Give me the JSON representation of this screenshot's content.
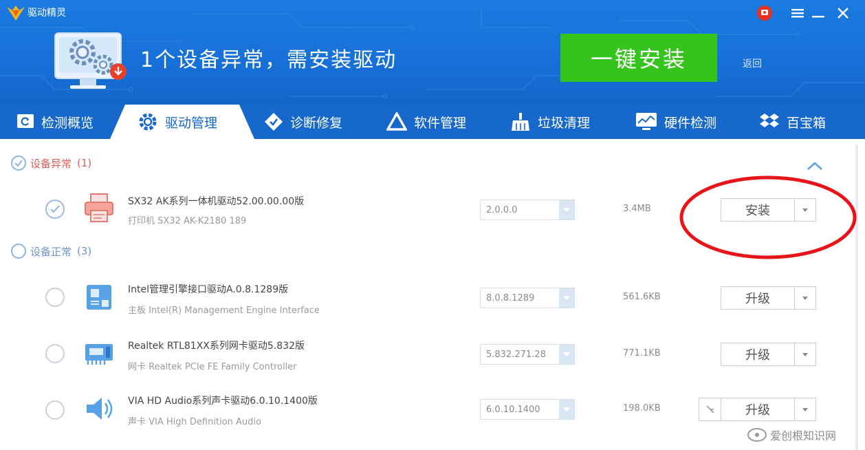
{
  "app": {
    "name": "驱动精灵"
  },
  "header": {
    "headline": "1个设备异常，需安装驱动",
    "install_all_label": "一键安装",
    "back_label": "返回"
  },
  "tabs": [
    {
      "label": "检测概览",
      "icon": "monitor-refresh-icon"
    },
    {
      "label": "驱动管理",
      "icon": "gear-icon",
      "active": true
    },
    {
      "label": "诊断修复",
      "icon": "diamond-wrench-icon"
    },
    {
      "label": "软件管理",
      "icon": "triangle-logo-icon"
    },
    {
      "label": "垃圾清理",
      "icon": "broom-icon"
    },
    {
      "label": "硬件检测",
      "icon": "chart-monitor-icon"
    },
    {
      "label": "百宝箱",
      "icon": "dropbox-icon"
    }
  ],
  "groups": {
    "abnormal": {
      "label": "设备异常",
      "count": "(1)"
    },
    "normal": {
      "label": "设备正常",
      "count": "(3)"
    }
  },
  "devices": [
    {
      "name": "SX32 AK系列一体机驱动52.00.00.00版",
      "sub": "打印机   SX32 AK-K2180 189",
      "version": "2.0.0.0",
      "size": "3.4MB",
      "action": "安装",
      "checked": true,
      "icon": "printer-icon"
    },
    {
      "name": "Intel管理引擎接口驱动A.0.8.1289版",
      "sub": "主板   Intel(R) Management Engine Interface",
      "version": "8.0.8.1289",
      "size": "561.6KB",
      "action": "升级",
      "checked": false,
      "icon": "motherboard-icon"
    },
    {
      "name": "Realtek RTL81XX系列网卡驱动5.832版",
      "sub": "网卡   Realtek PCIe FE Family Controller",
      "version": "5.832.271.28",
      "size": "771.1KB",
      "action": "升级",
      "checked": false,
      "icon": "network-card-icon"
    },
    {
      "name": "VIA HD Audio系列声卡驱动6.0.10.1400版",
      "sub": "声卡   VIA High Definition Audio",
      "version": "6.0.10.1400",
      "size": "198.0KB",
      "action": "升级",
      "checked": false,
      "icon": "speaker-icon"
    }
  ],
  "watermark": {
    "text": "爱创根知识网"
  },
  "colors": {
    "header_blue": "#1a7be0",
    "tab_bar": "#1668cd",
    "install_green": "#34c41c",
    "highlight_red": "#e8141a",
    "abnormal_red": "#e25b5b"
  }
}
